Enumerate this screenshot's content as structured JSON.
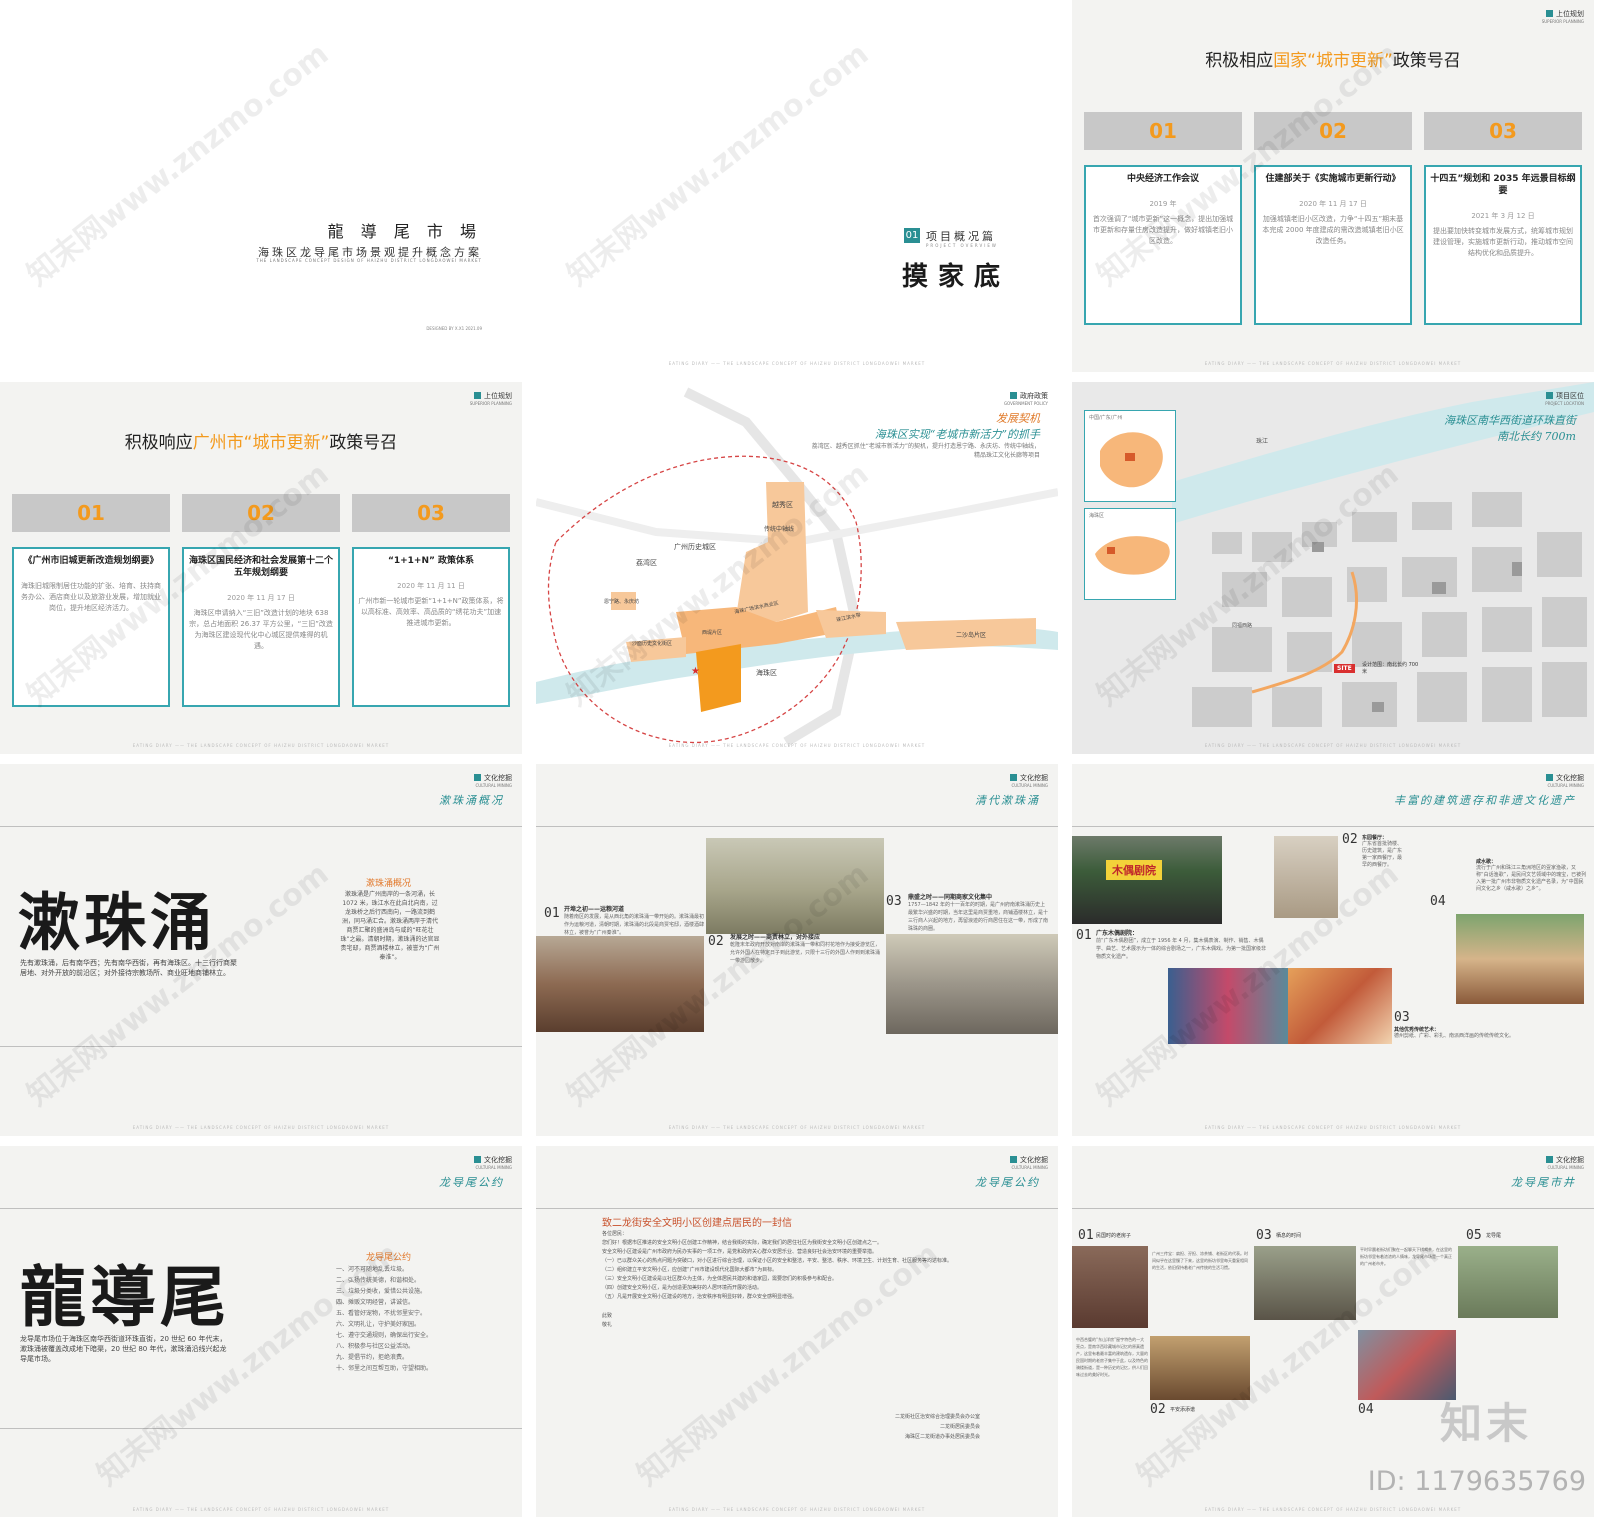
{
  "footer_text": "EATING DIARY ——  THE LANDSCAPE CONCEPT OF HAIZHU DISTRICT LONGDAOWEI MARKET",
  "colors": {
    "teal": "#2a8f93",
    "orange": "#f39a1e",
    "orange_map": "#f7b77a",
    "river": "#cfe9ec"
  },
  "slide1": {
    "title": "龍 導 尾 市 場",
    "subtitle": "海珠区龙导尾市场景观提升概念方案",
    "en": "THE LANDSCAPE CONCEPT DESIGN OF HAIZHU DISTRICT LONGDAOWEI MARKET",
    "designed": "DESIGNED BY X.X1   2021.09"
  },
  "slide2": {
    "num": "01",
    "section": "项目概况篇",
    "section_en": "PROJECT OVERVIEW",
    "big": "摸家底"
  },
  "slide3": {
    "tag": "上位规划",
    "tag_en": "SUPERIOR PLANNING",
    "title_a": "积极相应",
    "title_hl": "国家“城市更新”",
    "title_b": "政策号召",
    "cards": [
      {
        "num": "01",
        "title": "中央经济工作会议",
        "date": "2019 年",
        "text": "首次强调了“城市更新”这一概念，提出加强城市更新和存量住房改造提升，做好城镇老旧小区改造。"
      },
      {
        "num": "02",
        "title": "住建部关于《实施城市更新行动》",
        "date": "2020 年 11 月 17 日",
        "text": "加强城镇老旧小区改造，力争“十四五”期末基本完成 2000 年度建成的需改造城镇老旧小区改造任务。"
      },
      {
        "num": "03",
        "title": "十四五”规划和 2035 年远景目标纲要",
        "date": "2021 年 3 月 12 日",
        "text": "提出要加快转变城市发展方式，统筹城市规划建设管理，实施城市更新行动，推动城市空间结构优化和品质提升。"
      }
    ]
  },
  "slide4": {
    "tag": "上位规划",
    "tag_en": "SUPERIOR PLANNING",
    "title_a": "积极响应",
    "title_hl": "广州市“城市更新”",
    "title_b": "政策号召",
    "cards": [
      {
        "num": "01",
        "title": "《广州市旧城更新改造规划纲要》",
        "date": "",
        "text": "海珠旧城限制居住功能的扩张、培育、扶持商务办公、酒店商业以及旅游业发展，增加就业岗位，提升地区经济活力。"
      },
      {
        "num": "02",
        "title": "海珠区国民经济和社会发展第十二个五年规划纲要",
        "date": "2020 年 11 月 17 日",
        "text": "海珠区申请纳入“三旧”改造计划的地块 638 宗，总占地面积 26.37 平方公里，“三旧”改造为海珠区建设现代化中心城区提供难得的机遇。"
      },
      {
        "num": "03",
        "title": "“1+1+N” 政策体系",
        "date": "2020 年 11 月 11 日",
        "text": "广州市新一轮城市更新“1+1+N”政策体系，将以高标准、高效率、高品质的“绣花功夫”加速推进城市更新。"
      }
    ]
  },
  "slide5": {
    "tag": "政府政策",
    "tag_en": "GOVERNMENT POLICY",
    "head1": "发展契机",
    "head2": "海珠区实现“老城市新活力”的抓手",
    "note": "荔湾区、越秀区抓住“老城市新活力”的契机，提升打造恩宁路、永庆坊、传统中轴线，精品珠江文化长廊等项目",
    "labels": {
      "yuexiu": "越秀区",
      "axis": "传统中轴线",
      "history": "广州历史城区",
      "liwan": "荔湾区",
      "enning": "恩宁路、永庆坊",
      "shamian": "沙面历史文化街区",
      "xidi": "西堤片区",
      "corridor": "海珠广场滨水商业区",
      "river_belt": "珠江滨水带",
      "ersha": "二沙岛片区",
      "haizhu": "海珠区"
    }
  },
  "slide6": {
    "tag": "项目区位",
    "tag_en": "PROJECT LOCATION",
    "head1": "海珠区南华西街道环珠直街",
    "head2": "南北长约 700m",
    "inset1": "中国/广东/广州",
    "inset2": "海珠区",
    "river": "珠江",
    "site": "SITE",
    "site_note": "设计范围：南北长约 700 米",
    "poi": "同福西路"
  },
  "slide7": {
    "tag": "文化挖掘",
    "tag_en": "CULTURAL MINING",
    "vtitle": "漱珠涌概况",
    "big": "漱珠涌",
    "text": "先有漱珠涌，后有南华西；先有南华西街，再有海珠区。十三行行商聚居地、对外开放的前沿区；对外接待宗教场所、商业旺地商铺林立。",
    "side_title": "漱珠涌概况",
    "side_text": "漱珠涌是广州南岸的一条河涌，长 1072 米，珠江水在此自北向南，过龙珠桥之后行西南向，一路流到鹤洲，同马涌汇合。漱珠涌两岸于清代商贾汇聚的盛洲岛与咸的“旺花壮珠”之最。清朝时期，漱珠涌的达官显贵宅邸，商贾酒楼林立，被誉为“广州秦淮”。"
  },
  "slide8": {
    "tag": "文化挖掘",
    "tag_en": "CULTURAL MINING",
    "vtitle": "清代漱珠涌",
    "items": [
      {
        "num": "01",
        "title": "开埠之初——运粮河道",
        "text": "随着南区的发展，是从西北角的漱珠涌一带开始的。漱珠涌最初作为运粮河道，清朝时期，漱珠涌的北段是商贾宅邸，酒楼酒肆林立，被誉为“广州秦淮”。"
      },
      {
        "num": "02",
        "title": "发展之时——商贾林立，对外接应",
        "text": "乾隆末年政府开放对南岸的漱珠涌一带和同村花地作为接受游览区，允许外国人在特定日子到此游览，只限十三行的外国人作到到漱珠涌一带游园散步。"
      },
      {
        "num": "03",
        "title": "鼎盛之时——同期商家文化集中",
        "text": "1757—1842 年的十一百年的时期，是广州府南漱珠涌历史上最繁华兴盛的时期，当年这里是商贾重地，商铺酒楼林立，是十三行商人兴起的地方，再留浪迹的行商居住在这一带，形成了南珠珠的商圈。"
      }
    ]
  },
  "slide9": {
    "tag": "文化挖掘",
    "tag_en": "CULTURAL MINING",
    "vtitle": "丰富的建筑遗存和非遗文化遗产",
    "sign": "木偶剧院",
    "items": [
      {
        "num": "01",
        "title": "广东木偶剧院：",
        "text": "前“广东木偶剧团”，成立于 1956 年 4 月，集木偶表演、制作、销售、木偶学、曲艺、艺术展示为一体的综合剧场之一，广东木偶戏。为第一批国家级非物质文化遗产。"
      },
      {
        "num": "02",
        "title": "东园餐厅：",
        "text": "广东省首批骑楼、历史建筑，是广东第一家西餐厅，最早的西餐厅。"
      },
      {
        "num": "03",
        "title": "其他优秀传统艺术：",
        "text": "德州剪纸、广彩、彩扎、南派西洋画的传统传统文化。"
      },
      {
        "num": "04",
        "title": "咸水歌：",
        "text": "流行于广州和珠江三角洲地区的疍家渔歌，又称“白话渔歌”，是民间文艺领域中的瑰宝，已被列入第一批广州市非物质文化遗产名录，为“中国民间文化之乡（咸水歌）之乡”。"
      }
    ]
  },
  "slide10": {
    "tag": "文化挖掘",
    "tag_en": "CULTURAL MINING",
    "vtitle": "龙导尾公约",
    "big": "龍導尾",
    "text": "龙导尾市场位于海珠区南华西街道环珠直街，20 世纪 60 年代末，漱珠涌被覆盖改成地下暗渠，20 世纪 80 年代，漱珠涌沿线兴起龙导尾市场。",
    "list_title": "龙导尾公约",
    "list": [
      "一、河不可随地乱丢垃圾。",
      "二、弘扬传统美德，和谐相处。",
      "三、垃圾分类收，爱惜公共设施。",
      "四、摊贩文明经营，讲诚信。",
      "五、看管好宠物，不扰邻里安宁。",
      "六、文明礼让，守护美好家园。",
      "七、遵守交通规则，确保出行安全。",
      "八、积极参与社区公益活动。",
      "九、提倡节约，拒绝浪费。",
      "十、邻里之间互帮互助，守望相助。"
    ]
  },
  "slide11": {
    "tag": "文化挖掘",
    "tag_en": "CULTURAL MINING",
    "vtitle": "龙导尾公约",
    "title": "致二龙街安全文明小区创建点居民的一封信",
    "salutation": "各位居民：",
    "paras": [
      "您们好！根据市区推进的安全文明小区创建工作精神，结合我街的实际，确定我们的居住社区为我街安全文明小区创建点之一。",
      "安全文明小区建设是广州市政府为民办实事的一项工作，是党和政府关心群众安居乐业、营造良好社会治安环境的重要举措。",
      "（一）已以群众关心的热点问题为突破口，对小区进行综合治理，以保证小区的安全和整洁，平安、整洁、秩序、环境卫生、计划生育、社区服务等均达标准。",
      "（二）组织建立平安文明小区，应创建“广州市建设现代化国际大都市”为目标。",
      "（三）安全文明小区建设是以社区群众为主体，为全体居民共建的和谐家园，需要您们的积极参与和配合。",
      "（四）创建安全文明小区，是为创造更加美好的人居环境而开展的活动。",
      "（五）凡是开展安全文明小区建设的地方，治安秩序有明显好转，群众安全感明显增强。"
    ],
    "close": "此致",
    "respect": "敬礼",
    "signers": [
      "二龙街社区治安综合治理委员会办公室",
      "二龙街居民委员会",
      "海珠区二龙街道办事处居民委员会"
    ]
  },
  "slide12": {
    "tag": "文化挖掘",
    "tag_en": "CULTURAL MINING",
    "vtitle": "龙导尾市井",
    "items": [
      {
        "num": "01",
        "title": "民国时的老房子",
        "text": "中西合璧的“东山洋房”屋宇特色的一大亮点，是南华西珍藏城市记忆的原真遗产，这里有着最丰富的建筑遗存，大量的民国时期的老房子集中于此，以及特色的骑楼街道，是一种历史的记忆，供人们回味过去的美好时光。"
      },
      {
        "num": "02",
        "title": "平安添添谱",
        "text": ""
      },
      {
        "num": "03",
        "title": "栖息的时间",
        "text": "广州三传宝：扁担、孖担、凉茶铺、老街区的代表。时间似乎在这里慢了下来，这里的街坊邻里每天重复相同的生活，依旧保持着老广州传统的生活习惯。"
      },
      {
        "num": "04",
        "title": "",
        "text": ""
      },
      {
        "num": "05",
        "title": "龙导尾",
        "text": "平时早晨老街坊们聚在一起聊天下棋喝茶，在这里的街坊邻里有着浓浓的人情味，龙导尾市场是一个真正的广州老市井。"
      }
    ]
  },
  "watermark": "知末网www.znzmo.com",
  "brand": "知末",
  "id_label": "ID: 1179635769"
}
